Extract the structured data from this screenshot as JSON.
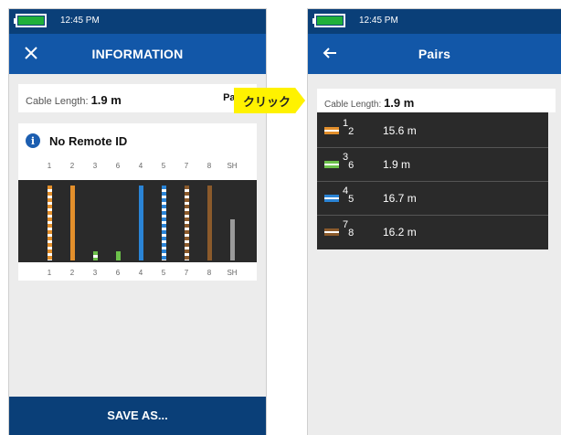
{
  "left": {
    "status_time": "12:45 PM",
    "title": "INFORMATION",
    "cable_label": "Cable Length:",
    "cable_value": "1.9 m",
    "pairs_link": "Pairs",
    "remote_title": "No Remote ID",
    "pins": [
      "1",
      "2",
      "3",
      "6",
      "4",
      "5",
      "7",
      "8",
      "SH"
    ],
    "wires": [
      {
        "pin": "1",
        "color": "#e38f2b",
        "striped": true,
        "level": 0.95
      },
      {
        "pin": "2",
        "color": "#e38f2b",
        "striped": false,
        "level": 0.95
      },
      {
        "pin": "3",
        "color": "#6cc04a",
        "striped": true,
        "level": 0.12
      },
      {
        "pin": "6",
        "color": "#6cc04a",
        "striped": false,
        "level": 0.12
      },
      {
        "pin": "4",
        "color": "#2a84d6",
        "striped": false,
        "level": 0.95
      },
      {
        "pin": "5",
        "color": "#2a84d6",
        "striped": true,
        "level": 0.95
      },
      {
        "pin": "7",
        "color": "#8b5a2b",
        "striped": true,
        "level": 0.95
      },
      {
        "pin": "8",
        "color": "#8b5a2b",
        "striped": false,
        "level": 0.95
      },
      {
        "pin": "SH",
        "color": "#9a9a9a",
        "striped": false,
        "level": 0.52
      }
    ],
    "save_label": "SAVE AS..."
  },
  "callout": {
    "text": "クリック"
  },
  "right": {
    "status_time": "12:45 PM",
    "title": "Pairs",
    "cable_label": "Cable Length:",
    "cable_value": "1.9 m",
    "pairs": [
      {
        "a": "1",
        "b": "2",
        "length": "15.6 m",
        "color": "#e38f2b"
      },
      {
        "a": "3",
        "b": "6",
        "length": "1.9 m",
        "color": "#6cc04a"
      },
      {
        "a": "4",
        "b": "5",
        "length": "16.7 m",
        "color": "#2a84d6"
      },
      {
        "a": "7",
        "b": "8",
        "length": "16.2 m",
        "color": "#8b5a2b"
      }
    ]
  }
}
